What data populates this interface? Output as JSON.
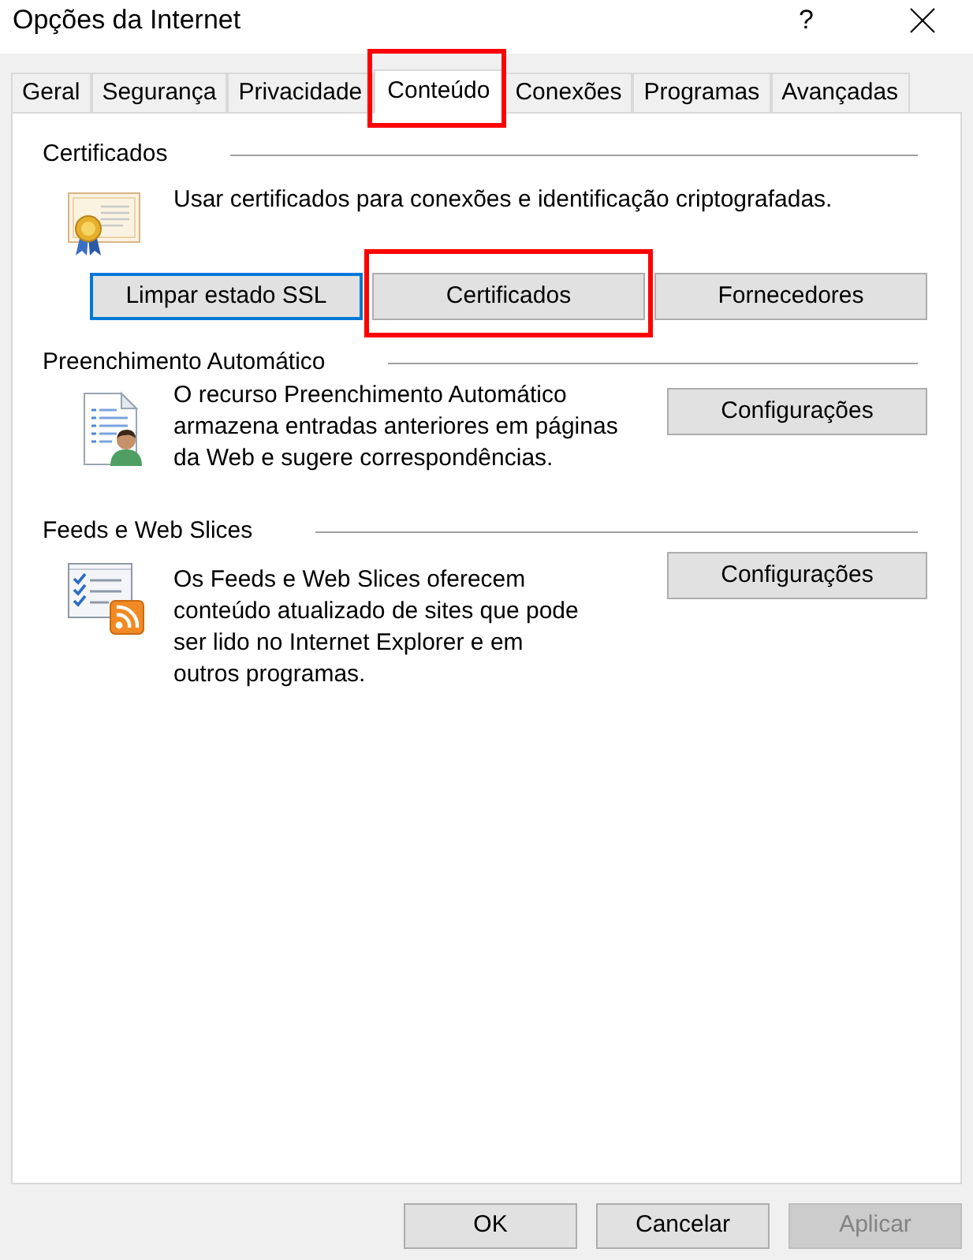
{
  "window": {
    "title": "Opções da Internet",
    "help_label": "?"
  },
  "tabs": [
    {
      "label": "Geral",
      "selected": false,
      "highlighted": false
    },
    {
      "label": "Segurança",
      "selected": false,
      "highlighted": false
    },
    {
      "label": "Privacidade",
      "selected": false,
      "highlighted": false
    },
    {
      "label": "Conteúdo",
      "selected": true,
      "highlighted": true
    },
    {
      "label": "Conexões",
      "selected": false,
      "highlighted": false
    },
    {
      "label": "Programas",
      "selected": false,
      "highlighted": false
    },
    {
      "label": "Avançadas",
      "selected": false,
      "highlighted": false
    }
  ],
  "sections": [
    {
      "kind": "certificates",
      "title": "Certificados",
      "description": "Usar certificados para conexões e identificação criptografadas.",
      "buttons": [
        {
          "label": "Limpar estado SSL",
          "focused": true,
          "highlighted": false
        },
        {
          "label": "Certificados",
          "focused": false,
          "highlighted": true
        },
        {
          "label": "Fornecedores",
          "focused": false,
          "highlighted": false
        }
      ]
    },
    {
      "kind": "autocomplete",
      "title": "Preenchimento Automático",
      "description": "O recurso Preenchimento Automático armazena entradas anteriores em páginas da Web e sugere correspondências.",
      "buttons": [
        {
          "label": "Configurações",
          "focused": false,
          "highlighted": false
        }
      ]
    },
    {
      "kind": "feeds",
      "title": "Feeds e Web Slices",
      "description": "Os Feeds e Web Slices oferecem conteúdo atualizado de sites que pode ser lido no Internet Explorer e em outros programas.",
      "buttons": [
        {
          "label": "Configurações",
          "focused": false,
          "highlighted": false
        }
      ]
    }
  ],
  "footer_buttons": [
    {
      "label": "OK",
      "disabled": false
    },
    {
      "label": "Cancelar",
      "disabled": false
    },
    {
      "label": "Aplicar",
      "disabled": true
    }
  ]
}
